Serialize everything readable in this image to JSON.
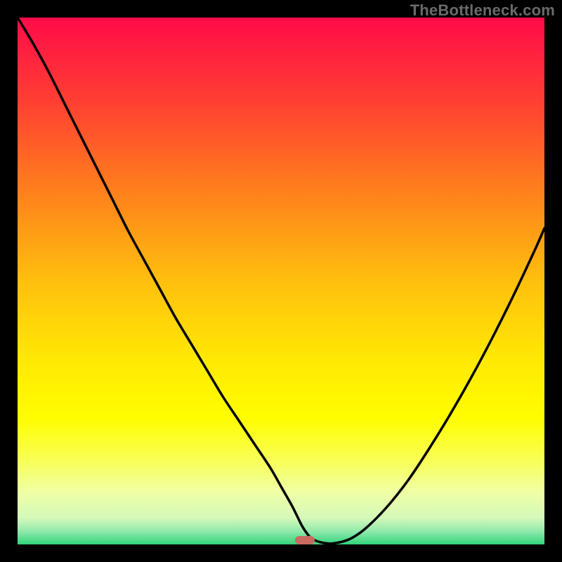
{
  "watermark": "TheBottleneck.com",
  "chart_data": {
    "type": "line",
    "title": "",
    "xlabel": "",
    "ylabel": "",
    "xlim": [
      0,
      100
    ],
    "ylim": [
      0,
      100
    ],
    "grid": false,
    "legend": false,
    "background_gradient_stops": [
      {
        "pos": 0.0,
        "color": "#ff0b49"
      },
      {
        "pos": 0.16,
        "color": "#ff3f32"
      },
      {
        "pos": 0.33,
        "color": "#ff801c"
      },
      {
        "pos": 0.5,
        "color": "#ffbf0e"
      },
      {
        "pos": 0.65,
        "color": "#ffe904"
      },
      {
        "pos": 0.76,
        "color": "#fffd00"
      },
      {
        "pos": 0.84,
        "color": "#f8ff55"
      },
      {
        "pos": 0.9,
        "color": "#f0ffa4"
      },
      {
        "pos": 0.95,
        "color": "#d4f9ba"
      },
      {
        "pos": 0.975,
        "color": "#8fe9ab"
      },
      {
        "pos": 1.0,
        "color": "#33d47c"
      }
    ],
    "series": [
      {
        "name": "bottleneck-curve",
        "color": "#000000",
        "x": [
          0,
          3,
          6,
          9,
          12,
          15,
          18,
          21,
          24,
          27,
          30,
          33,
          36,
          39,
          42,
          45,
          48,
          50,
          52,
          53,
          54,
          55,
          56,
          58,
          60,
          63,
          66,
          70,
          74,
          78,
          82,
          86,
          90,
          94,
          98,
          100
        ],
        "y": [
          100,
          95,
          89.5,
          83.5,
          77.5,
          71.5,
          65.5,
          59.5,
          54,
          48.5,
          43,
          38,
          33,
          28,
          23.5,
          19,
          14.5,
          11,
          7.5,
          5.5,
          3.5,
          2,
          1,
          0.3,
          0.2,
          1,
          3,
          7,
          12,
          18,
          24.5,
          31.5,
          39,
          47,
          55.5,
          60
        ]
      }
    ],
    "marker": {
      "x": 54.5,
      "y": 0.8,
      "color": "#c96a61"
    }
  }
}
